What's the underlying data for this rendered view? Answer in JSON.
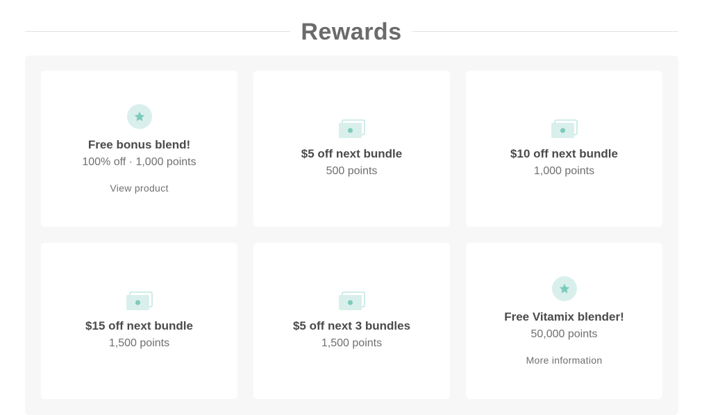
{
  "section": {
    "title": "Rewards"
  },
  "accent_color": "#7ccbbc",
  "rewards": [
    {
      "icon": "star-icon",
      "title": "Free bonus blend!",
      "subtitle": "100% off · 1,000 points",
      "link": "View product"
    },
    {
      "icon": "cash-icon",
      "title": "$5 off next bundle",
      "subtitle": "500 points",
      "link": ""
    },
    {
      "icon": "cash-icon",
      "title": "$10 off next bundle",
      "subtitle": "1,000 points",
      "link": ""
    },
    {
      "icon": "cash-icon",
      "title": "$15 off next bundle",
      "subtitle": "1,500 points",
      "link": ""
    },
    {
      "icon": "cash-icon",
      "title": "$5 off next 3 bundles",
      "subtitle": "1,500 points",
      "link": ""
    },
    {
      "icon": "star-icon",
      "title": "Free Vitamix blender!",
      "subtitle": "50,000 points",
      "link": "More information"
    }
  ]
}
